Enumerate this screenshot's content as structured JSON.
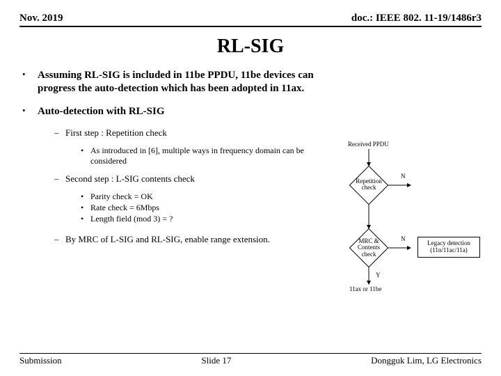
{
  "header": {
    "left": "Nov. 2019",
    "right": "doc.: IEEE 802. 11-19/1486r3"
  },
  "title": "RL-SIG",
  "bullets": {
    "p1": "Assuming RL-SIG is included in 11be PPDU, 11be devices can progress the auto-detection which has been adopted in 11ax.",
    "p2": "Auto-detection with RL-SIG",
    "s1": "First step : Repetition check",
    "s1a": "As introduced in [6], multiple ways in frequency domain can be considered",
    "s2": "Second step : L-SIG contents check",
    "s2a": "Parity check  = OK",
    "s2b": "Rate check = 6Mbps",
    "s2c": "Length field (mod 3) = ?",
    "s3": "By MRC of L-SIG and RL-SIG, enable range extension."
  },
  "flow": {
    "top": "Received PPDU",
    "d1": "Repetition\ncheck",
    "d2": "MRC &\nContents\ncheck",
    "n1": "N",
    "n2": "N",
    "y": "Y",
    "end": "11ax or 11be",
    "legacy": "Legacy detection\n(11n/11ac/11a)"
  },
  "footer": {
    "left": "Submission",
    "mid": "Slide 17",
    "right": "Dongguk Lim, LG Electronics"
  }
}
